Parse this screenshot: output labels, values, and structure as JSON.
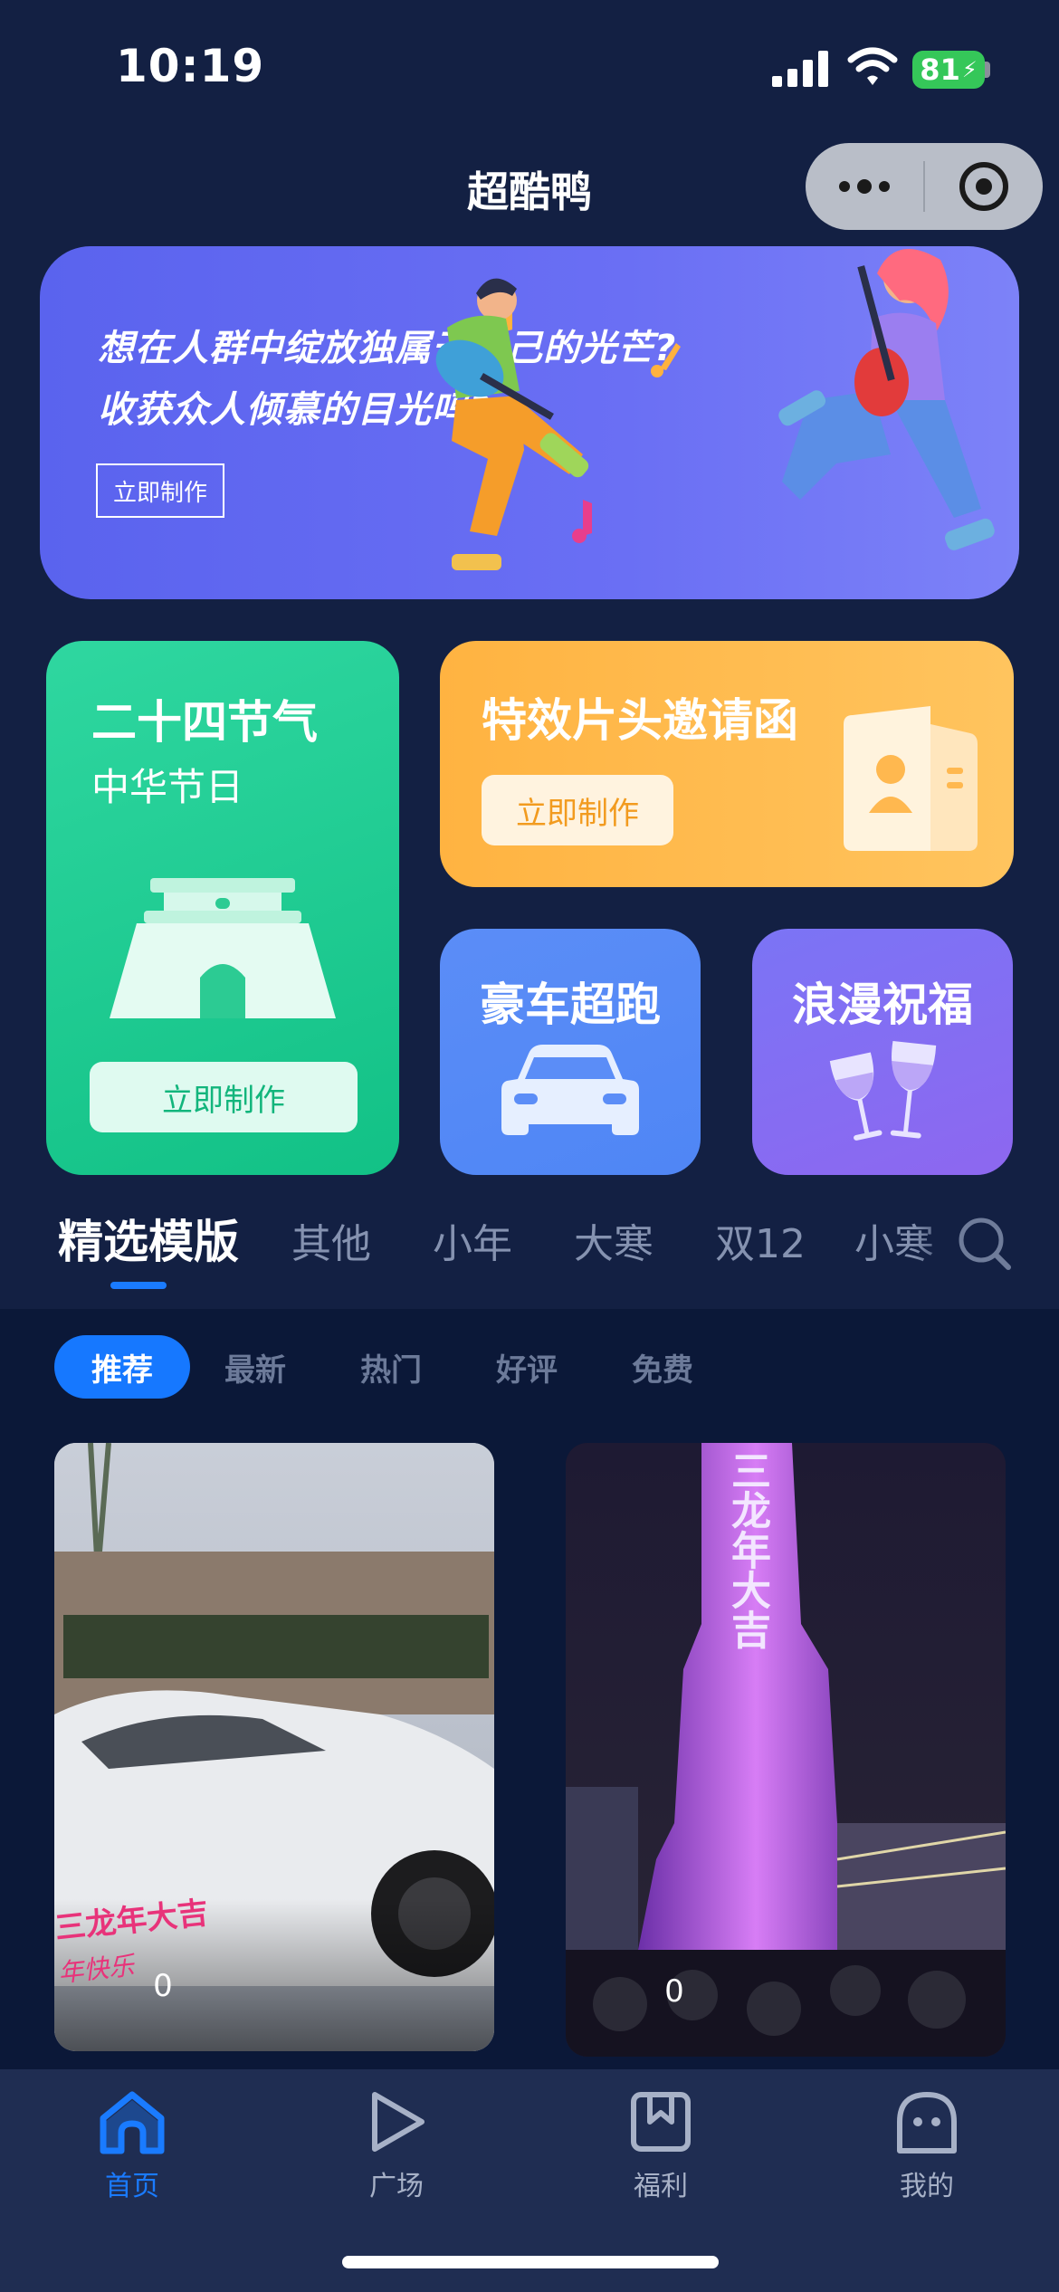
{
  "status_bar": {
    "time": "10:19",
    "battery": "81"
  },
  "header": {
    "title": "超酷鸭"
  },
  "banner": {
    "line1": "想在人群中绽放独属于自己的光芒?",
    "line2": "收获众人倾慕的目光吗?",
    "button": "立即制作"
  },
  "cards": {
    "solar_terms": {
      "title": "二十四节气",
      "subtitle": "中华节日",
      "button": "立即制作"
    },
    "invitation": {
      "title": "特效片头邀请函",
      "button": "立即制作"
    },
    "luxury_car": {
      "title": "豪车超跑"
    },
    "romantic": {
      "title": "浪漫祝福"
    }
  },
  "category_tabs": [
    "精选模版",
    "其他",
    "小年",
    "大寒",
    "双12",
    "小寒"
  ],
  "filter_chips": [
    "推荐",
    "最新",
    "热门",
    "好评",
    "免费"
  ],
  "feed": [
    {
      "count": "0",
      "overlay_line1": "三龙年大吉",
      "overlay_line2": "年快乐"
    },
    {
      "count": "0",
      "overlay_text": "三龙年大吉"
    }
  ],
  "tabbar": [
    "首页",
    "广场",
    "福利",
    "我的"
  ],
  "colors": {
    "accent": "#1a7bff",
    "background": "#132043",
    "feed_background": "#0b1838"
  }
}
